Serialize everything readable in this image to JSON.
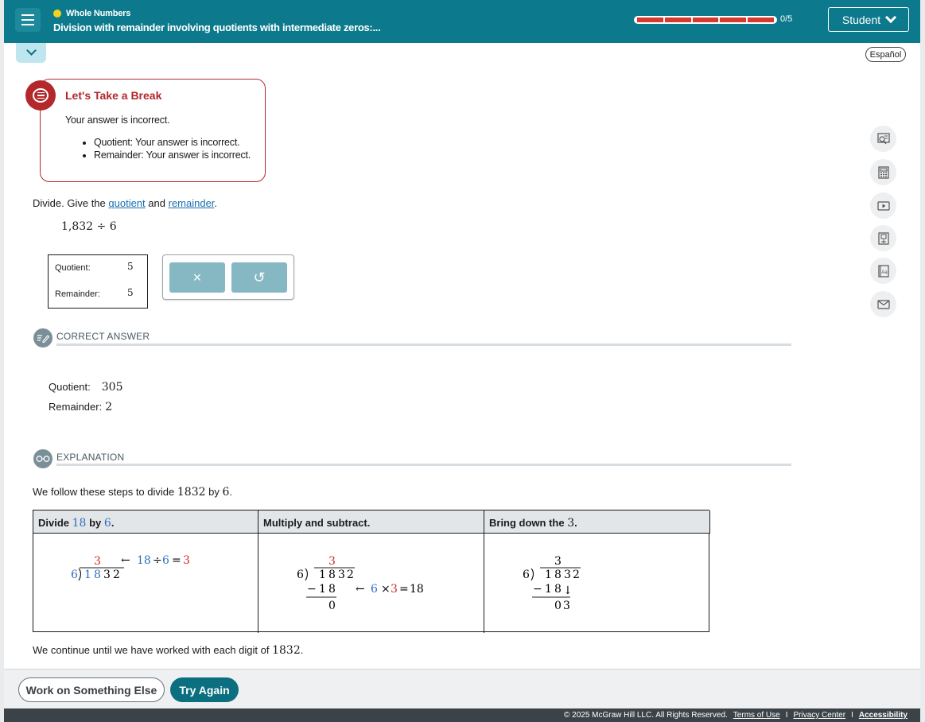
{
  "header": {
    "topic": "Whole Numbers",
    "lesson": "Division with remainder involving quotients with intermediate zeros:...",
    "progress_text": "0/5",
    "progress_fraction": 0,
    "student_label": "Student",
    "colors": {
      "bar": "#0c7a8c",
      "dot": "#f3d31e",
      "progress_segments": "#d63a2e"
    }
  },
  "espanol_label": "Español",
  "feedback": {
    "title": "Let's Take a Break",
    "message": "Your answer is incorrect.",
    "items": [
      "Quotient: Your answer is incorrect.",
      "Remainder: Your answer is incorrect."
    ],
    "icon": "chat-bubble-icon",
    "color": "#b2282b"
  },
  "question": {
    "prefix": "Divide. Give the",
    "link1": "quotient",
    "middle": "and",
    "link2": "remainder",
    "suffix": ".",
    "expression": "1,832 ÷ 6"
  },
  "answers": {
    "quotient_label": "Quotient:",
    "quotient_value": "5",
    "remainder_label": "Remainder:",
    "remainder_value": "5"
  },
  "tools": {
    "clear_symbol": "×",
    "undo_symbol": "↺"
  },
  "correct": {
    "title": "CORRECT ANSWER",
    "quotient_label": "Quotient:",
    "quotient_value": "305",
    "remainder_label": "Remainder:",
    "remainder_value": "2"
  },
  "explanation": {
    "title": "EXPLANATION",
    "intro_a": "We follow these steps to divide",
    "intro_num": "1832",
    "intro_b": "by",
    "intro_div": "6",
    "intro_end": ".",
    "steps": {
      "h1_a": "Divide",
      "h1_num": "18",
      "h1_b": "by",
      "h1_div": "6",
      "h1_end": ".",
      "h2": "Multiply and subtract.",
      "h3_a": "Bring down the",
      "h3_num": "3",
      "h3_end": "."
    },
    "continue_a": "We continue until we have worked with each digit of",
    "continue_num": "1832",
    "continue_end": "."
  },
  "buttons": {
    "work_else": "Work on Something Else",
    "try_again": "Try Again"
  },
  "footer": {
    "copyright": "© 2025 McGraw Hill LLC. All Rights Reserved.",
    "terms": "Terms of Use",
    "sep": "I",
    "privacy": "Privacy Center",
    "accessibility": "Accessibility"
  },
  "side_tools": [
    "reader-icon",
    "calculator-icon",
    "video-icon",
    "textbook-icon",
    "glossary-icon",
    "mail-icon"
  ]
}
